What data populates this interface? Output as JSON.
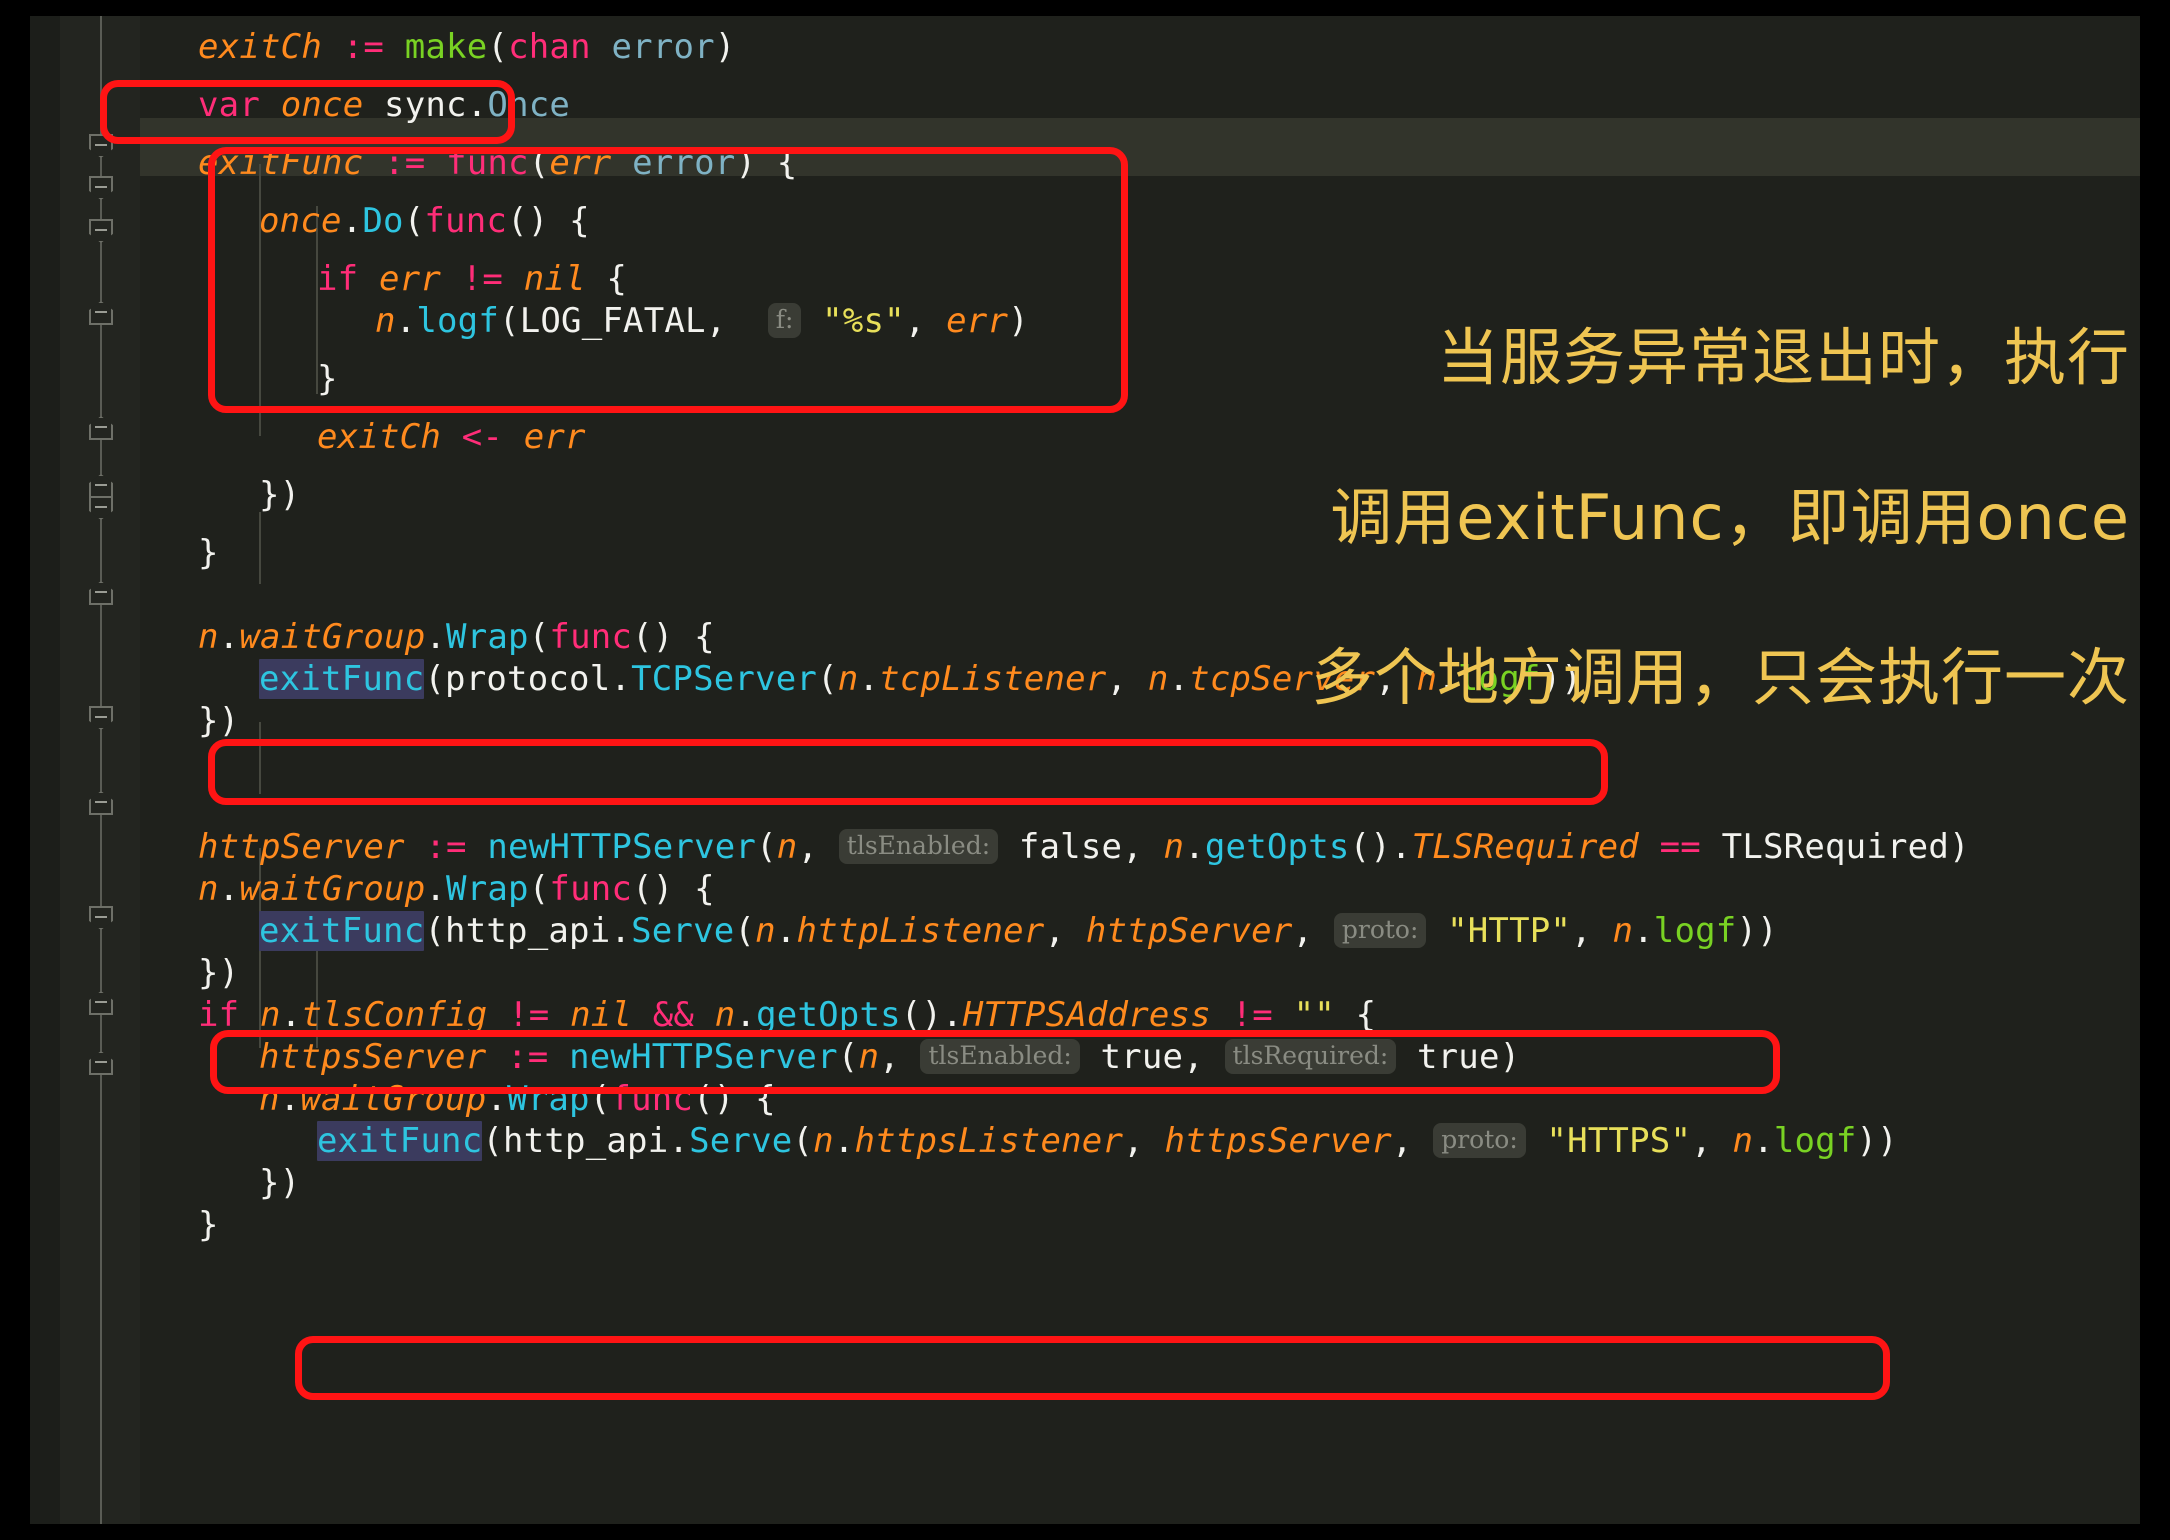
{
  "window": {
    "background_color": "#000000",
    "editor_background": "#1f211c",
    "gutter_background": "#232520",
    "caret_line_color": "#32342b"
  },
  "palette": {
    "keyword": "#ff2d78",
    "variable": "#ff8a1e",
    "type": "#7fb2c4",
    "function": "#2ec5e0",
    "builtin_green": "#79d223",
    "string": "#e8e05a",
    "plain_text": "#f2f2ee",
    "annotation_red": "#ff1414",
    "note_gold": "#efc552",
    "occurrence_highlight": "#3b3b5e",
    "hint_chip_bg": "#3a3c35",
    "hint_chip_fg": "#8a8c83"
  },
  "code": {
    "language": "Go",
    "lines": [
      {
        "indent": 1,
        "text": "exitCh := make(chan error)"
      },
      {
        "indent": 1,
        "text": "var once sync.Once"
      },
      {
        "indent": 1,
        "text": "exitFunc := func(err error) {",
        "caret_line": true
      },
      {
        "indent": 2,
        "text": "once.Do(func() {"
      },
      {
        "indent": 3,
        "text": "if err != nil {"
      },
      {
        "indent": 4,
        "text": "n.logf(LOG_FATAL, f: \"%s\", err)"
      },
      {
        "indent": 3,
        "text": "}"
      },
      {
        "indent": 3,
        "text": "exitCh <- err"
      },
      {
        "indent": 2,
        "text": "})"
      },
      {
        "indent": 1,
        "text": "}"
      },
      {
        "indent": 0,
        "text": ""
      },
      {
        "indent": 1,
        "text": "n.waitGroup.Wrap(func() {"
      },
      {
        "indent": 2,
        "text": "exitFunc(protocol.TCPServer(n.tcpListener, n.tcpServer, n.logf))"
      },
      {
        "indent": 1,
        "text": "})"
      },
      {
        "indent": 0,
        "text": ""
      },
      {
        "indent": 0,
        "text": ""
      },
      {
        "indent": 1,
        "text": "httpServer := newHTTPServer(n, tlsEnabled: false, n.getOpts().TLSRequired == TLSRequired)"
      },
      {
        "indent": 1,
        "text": "n.waitGroup.Wrap(func() {"
      },
      {
        "indent": 2,
        "text": "exitFunc(http_api.Serve(n.httpListener, httpServer, proto: \"HTTP\", n.logf))"
      },
      {
        "indent": 1,
        "text": "})"
      },
      {
        "indent": 1,
        "text": "if n.tlsConfig != nil && n.getOpts().HTTPSAddress != \"\" {"
      },
      {
        "indent": 2,
        "text": "httpsServer := newHTTPServer(n, tlsEnabled: true, tlsRequired: true)"
      },
      {
        "indent": 2,
        "text": "n.waitGroup.Wrap(func() {"
      },
      {
        "indent": 3,
        "text": "exitFunc(http_api.Serve(n.httpsListener, httpsServer, proto: \"HTTPS\", n.logf))"
      },
      {
        "indent": 2,
        "text": "})"
      },
      {
        "indent": 1,
        "text": "}"
      }
    ]
  },
  "tokens": {
    "l1": {
      "v_exitCh": "exitCh",
      "op_assign": ":=",
      "fn_make": "make",
      "p_open": "(",
      "kw_chan": "chan",
      "t_error": "error",
      "p_close": ")"
    },
    "l2": {
      "kw_var": "var",
      "v_once": "once",
      "pkg_sync": "sync.",
      "t_Once": "Once"
    },
    "l3": {
      "v_exitFunc": "exitFunc",
      "op_assign": ":=",
      "kw_func": "func",
      "p_open": "(",
      "v_err": "err",
      "t_error": "error",
      "p_close": ")",
      "brace": "{"
    },
    "l4": {
      "v_once": "once",
      "dot": ".",
      "fn_Do": "Do",
      "p_open": "(",
      "kw_func": "func",
      "parens": "()",
      "brace": "{"
    },
    "l5": {
      "kw_if": "if",
      "v_err": "err",
      "op_neq": "!=",
      "v_nil": "nil",
      "brace": "{"
    },
    "l6": {
      "v_n": "n",
      "dot": ".",
      "fn_logf": "logf",
      "p_open": "(",
      "c_LOG_FATAL": "LOG_FATAL",
      "comma": ",",
      "hint_f": "f:",
      "str_fmt": "\"%s\"",
      "v_err": "err",
      "p_close": ")"
    },
    "l7": {
      "brace": "}"
    },
    "l8": {
      "v_exitCh": "exitCh",
      "op_send": "<-",
      "v_err": "err"
    },
    "l9": {
      "close": "})"
    },
    "l10": {
      "brace": "}"
    },
    "l12": {
      "v_n": "n",
      "dot": ".",
      "f_waitGroup": "waitGroup",
      "dot2": ".",
      "fn_Wrap": "Wrap",
      "p_open": "(",
      "kw_func": "func",
      "parens": "()",
      "brace": "{"
    },
    "l13": {
      "v_exitFunc": "exitFunc",
      "p_open": "(",
      "pkg_protocol": "protocol.",
      "fn_TCPServer": "TCPServer",
      "p_open2": "(",
      "v_n": "n",
      "f_tcpListener": "tcpListener",
      "f_tcpServer": "tcpServer",
      "fn_logf": "logf",
      "close": "))"
    },
    "l14": {
      "close": "})"
    },
    "l17": {
      "v_httpServer": "httpServer",
      "op_assign": ":=",
      "fn_newHTTPServer": "newHTTPServer",
      "p_open": "(",
      "v_n": "n",
      "hint_tlsEnabled": "tlsEnabled:",
      "c_false": "false",
      "fn_getOpts": "getOpts",
      "f_TLSRequired": "TLSRequired",
      "op_eq": "==",
      "c_TLSRequired": "TLSRequired",
      "p_close": ")"
    },
    "l18": {
      "v_n": "n",
      "f_waitGroup": "waitGroup",
      "fn_Wrap": "Wrap",
      "kw_func": "func",
      "brace": "{"
    },
    "l19": {
      "v_exitFunc": "exitFunc",
      "pkg_http_api": "http_api.",
      "fn_Serve": "Serve",
      "v_n": "n",
      "f_httpListener": "httpListener",
      "v_httpServer": "httpServer",
      "hint_proto": "proto:",
      "str_HTTP": "\"HTTP\"",
      "fn_logf": "logf",
      "close": "))"
    },
    "l20": {
      "close": "})"
    },
    "l21": {
      "kw_if": "if",
      "v_n": "n",
      "f_tlsConfig": "tlsConfig",
      "op_neq": "!=",
      "v_nil": "nil",
      "op_and": "&&",
      "fn_getOpts": "getOpts",
      "f_HTTPSAddress": "HTTPSAddress",
      "op_neq2": "!=",
      "str_empty": "\"\"",
      "brace": "{"
    },
    "l22": {
      "v_httpsServer": "httpsServer",
      "op_assign": ":=",
      "fn_newHTTPServer": "newHTTPServer",
      "v_n": "n",
      "hint_tlsEnabled": "tlsEnabled:",
      "c_true": "true",
      "hint_tlsRequired": "tlsRequired:",
      "c_true2": "true",
      "p_close": ")"
    },
    "l23": {
      "v_n": "n",
      "f_waitGroup": "waitGroup",
      "fn_Wrap": "Wrap",
      "kw_func": "func",
      "brace": "{"
    },
    "l24": {
      "v_exitFunc": "exitFunc",
      "pkg_http_api": "http_api.",
      "fn_Serve": "Serve",
      "v_n": "n",
      "f_httpsListener": "httpsListener",
      "v_httpsServer": "httpsServer",
      "hint_proto": "proto:",
      "str_HTTPS": "\"HTTPS\"",
      "fn_logf": "logf",
      "close": "))"
    },
    "l25": {
      "close": "})"
    },
    "l26": {
      "brace": "}"
    }
  },
  "annotations": {
    "notes": [
      "当服务异常退出时，执行",
      "调用exitFunc，即调用once",
      "多个地方调用，只会执行一次"
    ],
    "boxes": [
      {
        "name": "var-once-box",
        "targets": "var once sync.Once"
      },
      {
        "name": "once-do-block-box",
        "targets": "once.Do(func() { ... })"
      },
      {
        "name": "tcp-exitfunc-box",
        "targets": "exitFunc(protocol.TCPServer(...))"
      },
      {
        "name": "http-exitfunc-box",
        "targets": "exitFunc(http_api.Serve(... \"HTTP\" ...))"
      },
      {
        "name": "https-exitfunc-box",
        "targets": "exitFunc(http_api.Serve(... \"HTTPS\" ...))"
      }
    ]
  }
}
